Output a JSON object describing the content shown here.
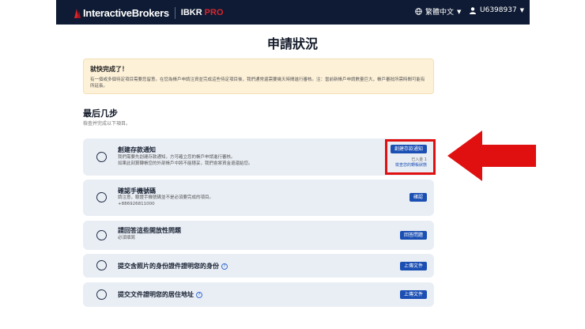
{
  "header": {
    "brand_name": "InteractiveBrokers",
    "brand_product": "IBKR",
    "brand_tier": "PRO",
    "language_label": "繁體中文",
    "username": "U6398937"
  },
  "page_title": "申請狀況",
  "notice": {
    "title": "就快完成了！",
    "body": "有一個或多個待定項目需要您留意。在您為帳戶申請注資並完成這些待定項目後，我們通常還需要幾天時間進行審核。注：當前新帳戶申請數量巨大，帳戶審批所需時間可能有所延長。"
  },
  "steps": {
    "title": "最后几步",
    "subtitle": "檢查并完成以下項目。"
  },
  "cards": [
    {
      "title": "創建存款通知",
      "desc_lines": [
        "我們需要先創建存款通知，方可確立您的帳戶申請進行審核。",
        "如果此刻算轉帳您的外部帳戶中將不能穩妥，我們會將資金退還給您。"
      ],
      "button": "創建存款通知",
      "status": "已入金 1",
      "status_link": "檢查您的轉帳狀態"
    },
    {
      "title": "確認手機號碼",
      "desc_lines": [
        "請注意，驗證手機號碼並不是必須要完成的項目。",
        "+886926811000"
      ],
      "button": "確認"
    },
    {
      "title": "請回答這些開放性問題",
      "desc_lines": [
        "必須填寫"
      ],
      "button": "回答問題"
    },
    {
      "title": "提交含照片的身份證件證明您的身份",
      "desc_lines": [],
      "button": "上傳文件"
    },
    {
      "title": "提交文件證明您的居住地址",
      "desc_lines": [],
      "button": "上傳文件"
    }
  ],
  "colors": {
    "topbar": "#0f1b34",
    "primary_button": "#1b4fb3",
    "card_bg": "#e9eef5",
    "notice_bg": "#fdf1d8",
    "annotation_red": "#e01010"
  }
}
